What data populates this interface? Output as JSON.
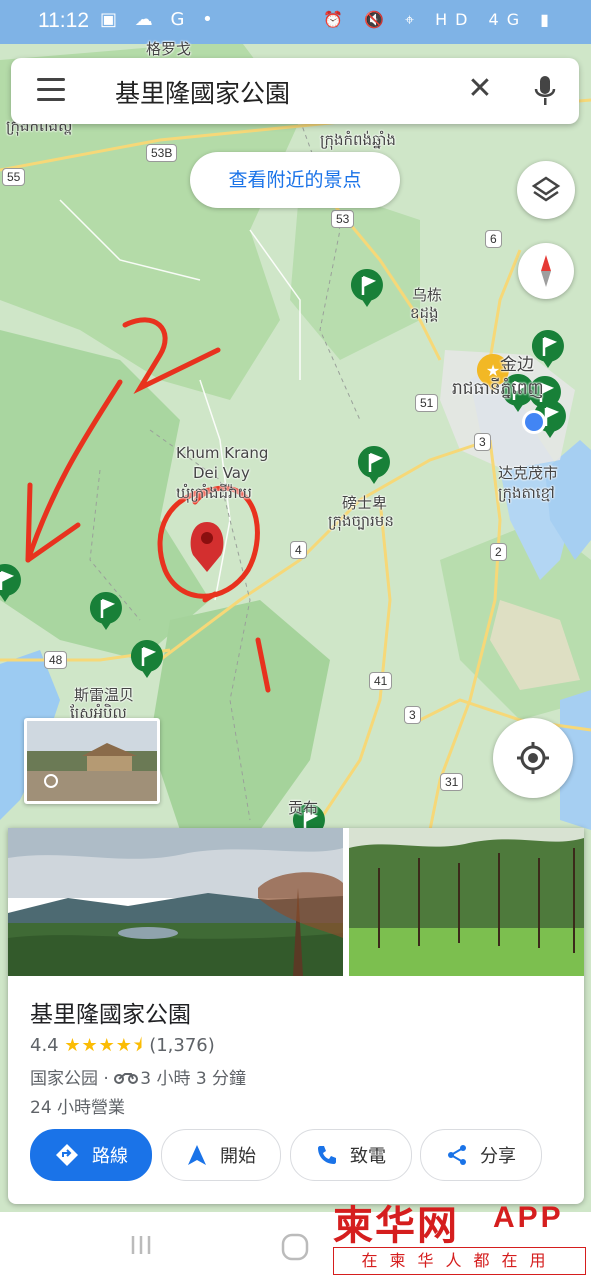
{
  "status_bar": {
    "time": "11:12",
    "left_icons": "▣ ☁ G •",
    "right_icons": "⏰ 🔇 ⌖ HD 4G ▮"
  },
  "search": {
    "query": "基里隆國家公園",
    "menu_icon": "hamburger-menu-icon",
    "clear_symbol": "✕",
    "mic_icon": "microphone-icon"
  },
  "nearby_button": {
    "label": "查看附近的景点"
  },
  "map": {
    "labels": [
      {
        "id": "gelongge",
        "text": "格罗戈"
      },
      {
        "id": "kh-top-left",
        "text": "ក្រុងកំពង់ស្ពឺ"
      },
      {
        "id": "kh-top",
        "text": "ក្រុងកំពង់ឆ្នាំង"
      },
      {
        "id": "wudong",
        "text": "乌栋"
      },
      {
        "id": "wudong-kh",
        "text": "ឧដុង្គ"
      },
      {
        "id": "jinbian",
        "text": "金边"
      },
      {
        "id": "phnompenh-kh",
        "text": "រាជធានីភ្នំពេញ"
      },
      {
        "id": "khum-krang",
        "text": "Khum Krang"
      },
      {
        "id": "dei-vay",
        "text": "Dei Vay"
      },
      {
        "id": "dei-vay-kh",
        "text": "ឃុំក្រាំងដីវ៉ាយ"
      },
      {
        "id": "bangshibei",
        "text": "磅士卑"
      },
      {
        "id": "bangshibei-kh",
        "text": "ក្រុងច្បារមន"
      },
      {
        "id": "dakemaoshi",
        "text": "达克茂市"
      },
      {
        "id": "dakemaoshi-kh",
        "text": "ក្រុងតាខ្មៅ"
      },
      {
        "id": "sileiwenbei",
        "text": "斯雷温贝"
      },
      {
        "id": "sileiwenbei-kh",
        "text": "ស្រែអំបិល"
      },
      {
        "id": "gongbu",
        "text": "贡布"
      }
    ],
    "route_shields": [
      {
        "id": "r53b",
        "text": "53B"
      },
      {
        "id": "r55",
        "text": "55"
      },
      {
        "id": "r53",
        "text": "53"
      },
      {
        "id": "r6",
        "text": "6"
      },
      {
        "id": "r51",
        "text": "51"
      },
      {
        "id": "r3a",
        "text": "3"
      },
      {
        "id": "r4",
        "text": "4"
      },
      {
        "id": "r2",
        "text": "2"
      },
      {
        "id": "r48",
        "text": "48"
      },
      {
        "id": "r41",
        "text": "41"
      },
      {
        "id": "r3b",
        "text": "3"
      },
      {
        "id": "r31",
        "text": "31"
      }
    ],
    "annotation_marks": [
      "2",
      "1"
    ],
    "colors": {
      "land": "#cfe6c8",
      "forest": "#a9d6a0",
      "water": "#9ccbf2",
      "road": "#f6d878",
      "pin": "#d32f2f",
      "flag": "#188038",
      "annotation": "#e8321e"
    }
  },
  "layers_icon": "layers-icon",
  "compass_icon": "compass-icon",
  "locate_icon": "my-location-icon",
  "place": {
    "name": "基里隆國家公園",
    "rating": "4.4",
    "stars": "★★★★⯨",
    "review_count": "(1,376)",
    "category": "国家公园",
    "separator": " · ",
    "travel_time": "3 小時 3 分鐘",
    "hours": "24 小時營業"
  },
  "actions": {
    "directions": "路線",
    "start": "開始",
    "call": "致電",
    "share": "分享"
  },
  "watermark": {
    "brand": "柬华网",
    "app": "APP",
    "slogan": "在柬华人都在用"
  }
}
